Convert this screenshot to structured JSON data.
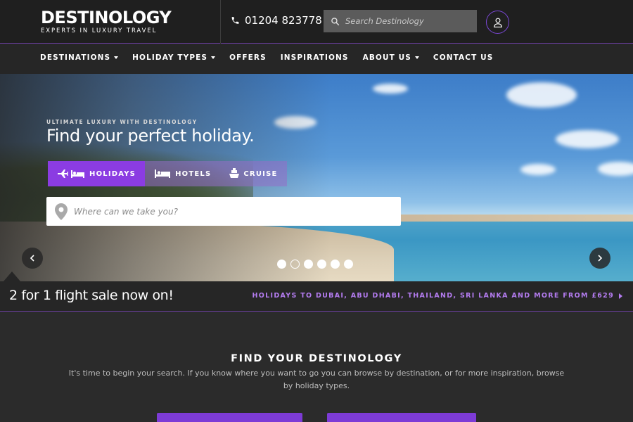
{
  "brand": {
    "name": "DESTINOLOGY",
    "tagline": "EXPERTS IN LUXURY TRAVEL"
  },
  "header": {
    "phone": "01204 823778",
    "search_placeholder": "Search Destinology",
    "icons": {
      "phone": "phone-icon",
      "search": "search-icon",
      "account": "user-icon"
    }
  },
  "nav": {
    "items": [
      {
        "label": "DESTINATIONS",
        "has_dropdown": true
      },
      {
        "label": "HOLIDAY TYPES",
        "has_dropdown": true
      },
      {
        "label": "OFFERS",
        "has_dropdown": false
      },
      {
        "label": "INSPIRATIONS",
        "has_dropdown": false
      },
      {
        "label": "ABOUT US",
        "has_dropdown": true
      },
      {
        "label": "CONTACT US",
        "has_dropdown": false
      }
    ]
  },
  "hero": {
    "tagline": "ULTIMATE LUXURY WITH DESTINOLOGY",
    "title": "Find your perfect holiday.",
    "tabs": [
      {
        "label": "HOLIDAYS",
        "icon": "plane-bed-icon",
        "active": true
      },
      {
        "label": "HOTELS",
        "icon": "bed-icon",
        "active": false
      },
      {
        "label": "CRUISE",
        "icon": "ship-icon",
        "active": false
      }
    ],
    "destination_placeholder": "Where can we take you?",
    "carousel": {
      "slide_count": 6,
      "active_index": 1
    }
  },
  "promo": {
    "left": "2 for 1 flight sale now on!",
    "right": "HOLIDAYS TO DUBAI, ABU DHABI, THAILAND, SRI LANKA AND MORE FROM £629"
  },
  "find": {
    "title": "FIND YOUR DESTINOLOGY",
    "description": "It's time to begin your search. If you know where you want to go you can browse by destination, or for more inspiration, browse by holiday types."
  },
  "colors": {
    "accent": "#8b3ce2",
    "accent_text": "#b47cf0",
    "header_bg": "#1f1f1f",
    "nav_bg": "#262626"
  }
}
